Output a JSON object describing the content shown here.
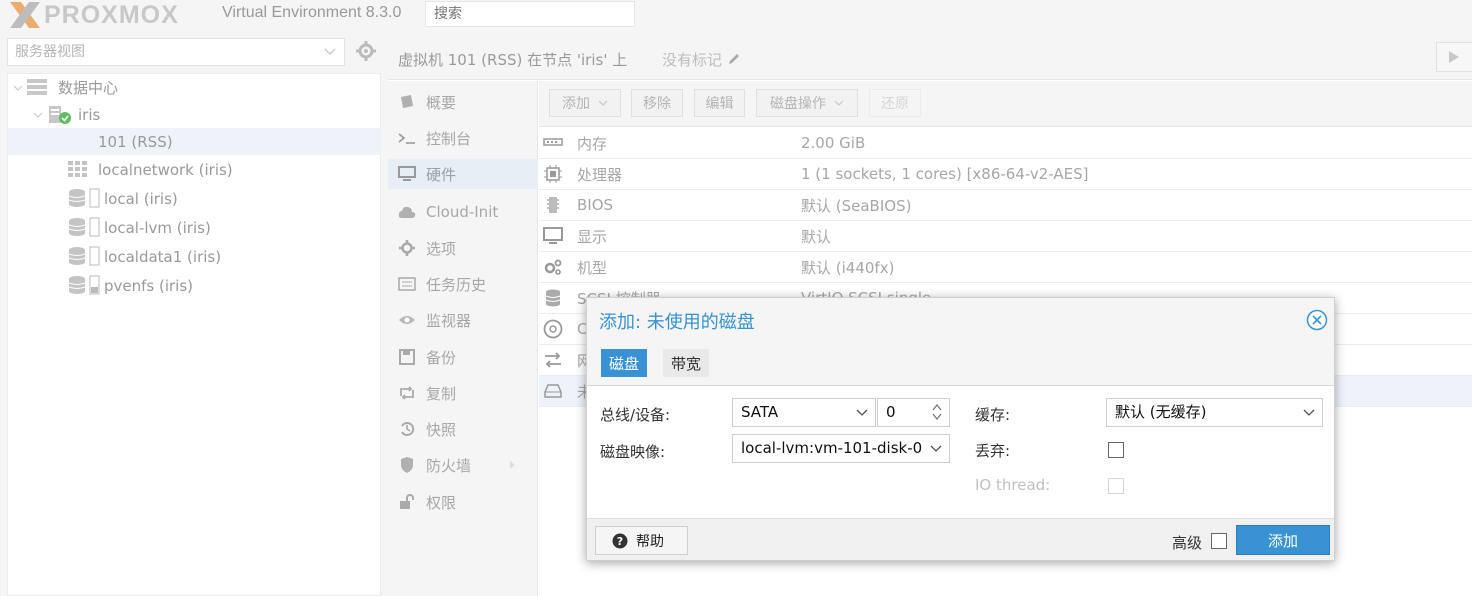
{
  "topbar": {
    "logo_text": "PROXMOX",
    "version": "Virtual Environment 8.3.0",
    "search_placeholder": "搜索"
  },
  "left": {
    "view_select": "服务器视图",
    "tree": [
      {
        "label": "数据中心",
        "icon": "datacenter-icon"
      },
      {
        "label": "iris",
        "icon": "node-icon"
      },
      {
        "label": "101 (RSS)",
        "icon": "vm-icon",
        "selected": true
      },
      {
        "label": "localnetwork (iris)",
        "icon": "network-grid-icon"
      },
      {
        "label": "local (iris)",
        "icon": "storage-icon"
      },
      {
        "label": "local-lvm (iris)",
        "icon": "storage-icon"
      },
      {
        "label": "localdata1 (iris)",
        "icon": "storage-icon"
      },
      {
        "label": "pvenfs (iris)",
        "icon": "storage-icon"
      }
    ]
  },
  "main": {
    "title": "虚拟机 101 (RSS) 在节点 'iris' 上",
    "tags": "没有标记",
    "nav": [
      {
        "label": "概要",
        "icon": "book-icon"
      },
      {
        "label": "控制台",
        "icon": "terminal-icon"
      },
      {
        "label": "硬件",
        "icon": "monitor-icon",
        "active": true
      },
      {
        "label": "Cloud-Init",
        "icon": "cloud-icon"
      },
      {
        "label": "选项",
        "icon": "gear-icon"
      },
      {
        "label": "任务历史",
        "icon": "list-icon"
      },
      {
        "label": "监视器",
        "icon": "eye-icon"
      },
      {
        "label": "备份",
        "icon": "floppy-icon"
      },
      {
        "label": "复制",
        "icon": "retweet-icon"
      },
      {
        "label": "快照",
        "icon": "history-icon"
      },
      {
        "label": "防火墙",
        "icon": "shield-icon"
      },
      {
        "label": "权限",
        "icon": "unlock-icon"
      }
    ],
    "toolbar": {
      "add": "添加",
      "remove": "移除",
      "edit": "编辑",
      "disk_action": "磁盘操作",
      "revert": "还原"
    },
    "hardware": [
      {
        "name": "内存",
        "value": "2.00 GiB",
        "icon": "memory-icon"
      },
      {
        "name": "处理器",
        "value": "1 (1 sockets, 1 cores) [x86-64-v2-AES]",
        "icon": "cpu-icon"
      },
      {
        "name": "BIOS",
        "value": "默认 (SeaBIOS)",
        "icon": "bios-icon"
      },
      {
        "name": "显示",
        "value": "默认",
        "icon": "display-icon"
      },
      {
        "name": "机型",
        "value": "默认 (i440fx)",
        "icon": "cogs-icon"
      },
      {
        "name": "SCSI 控制器",
        "value": "VirtIO SCSI single",
        "icon": "database-icon"
      },
      {
        "name": "C",
        "value": "",
        "icon": "cdrom-icon"
      },
      {
        "name": "网",
        "value": "",
        "icon": "network-icon"
      },
      {
        "name": "未",
        "value": "",
        "icon": "hdd-icon"
      }
    ]
  },
  "dialog": {
    "title": "添加: 未使用的磁盘",
    "tabs": [
      "磁盘",
      "带宽"
    ],
    "bus_label": "总线/设备:",
    "bus_value": "SATA",
    "device_value": "0",
    "image_label": "磁盘映像:",
    "image_value": "local-lvm:vm-101-disk-0",
    "cache_label": "缓存:",
    "cache_value": "默认 (无缓存)",
    "discard_label": "丢弃:",
    "iothread_label": "IO thread:",
    "help": "帮助",
    "advanced": "高级",
    "add": "添加"
  }
}
